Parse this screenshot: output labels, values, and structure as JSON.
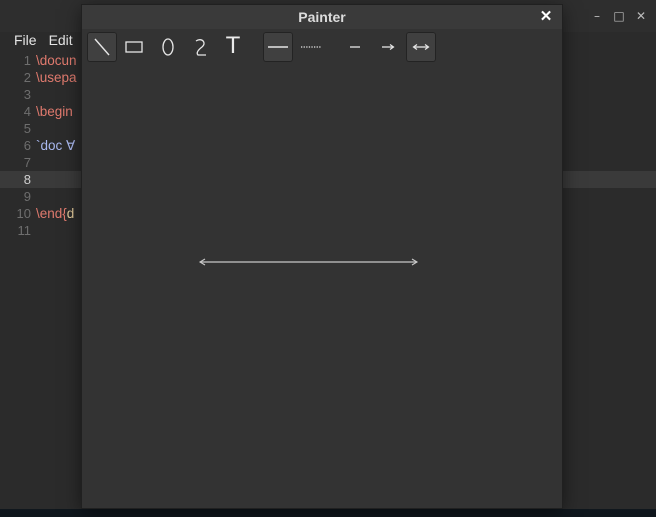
{
  "editor": {
    "menu": {
      "file": "File",
      "edit": "Edit"
    },
    "window_controls": {
      "minimize": "–",
      "maximize": "□",
      "close": "✕"
    },
    "lines": [
      {
        "n": "1",
        "parts": [
          {
            "t": "\\docun",
            "c": "kw"
          }
        ]
      },
      {
        "n": "2",
        "parts": [
          {
            "t": "\\usepa",
            "c": "kw"
          }
        ]
      },
      {
        "n": "3",
        "parts": []
      },
      {
        "n": "4",
        "parts": [
          {
            "t": "\\begin",
            "c": "kw"
          }
        ]
      },
      {
        "n": "5",
        "parts": []
      },
      {
        "n": "6",
        "parts": [
          {
            "t": "`doc ∀",
            "c": "doc"
          }
        ]
      },
      {
        "n": "7",
        "parts": []
      },
      {
        "n": "8",
        "parts": [],
        "current": true
      },
      {
        "n": "9",
        "parts": []
      },
      {
        "n": "10",
        "parts": [
          {
            "t": "\\end{",
            "c": "kw"
          },
          {
            "t": "d",
            "c": "plain"
          }
        ]
      },
      {
        "n": "11",
        "parts": []
      }
    ]
  },
  "painter": {
    "title": "Painter",
    "close_symbol": "✕",
    "tools": {
      "text_tool_glyph": "T"
    },
    "active_shape_tool": "line",
    "active_stroke_style": "solid",
    "active_arrow_style": "double-arrow",
    "canvas_shape": {
      "type": "line",
      "arrow": "both",
      "color": "#c8c8c8"
    }
  }
}
